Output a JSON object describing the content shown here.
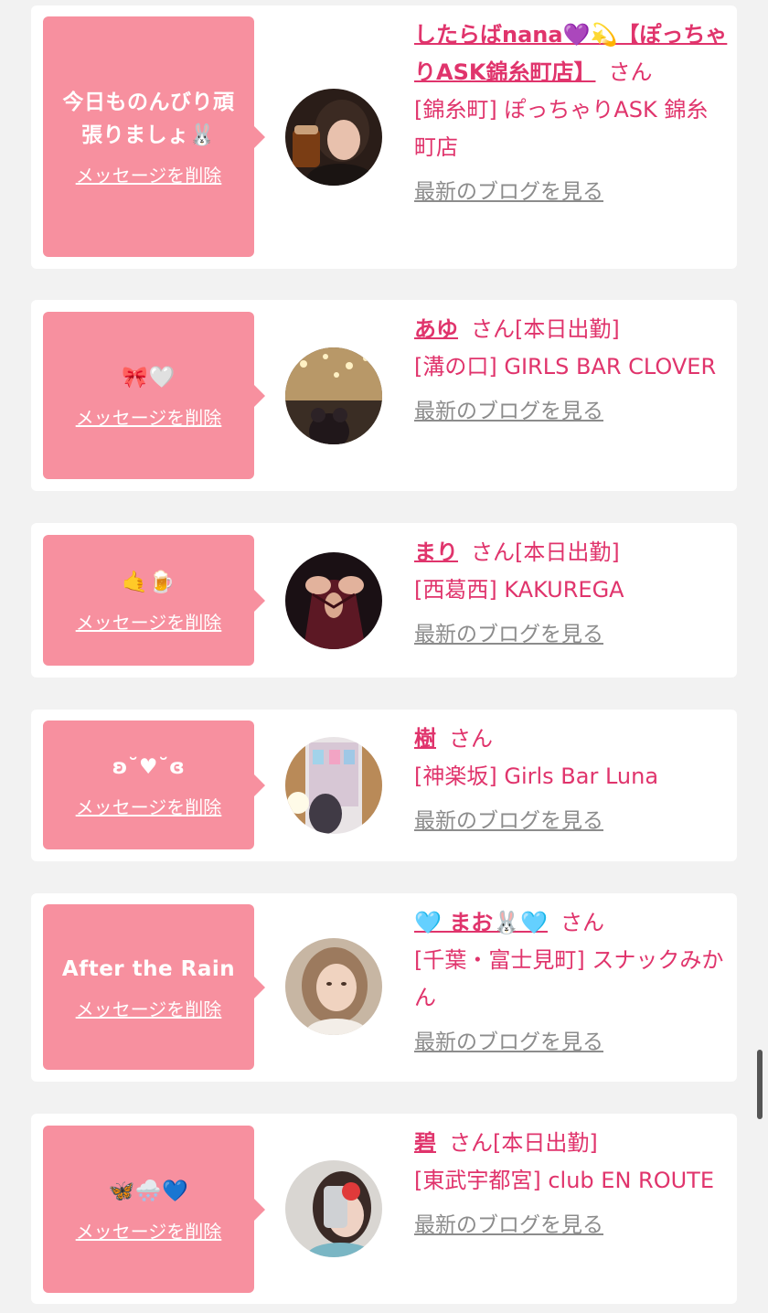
{
  "cards": [
    {
      "message": "今日ものんびり頑張りましょ🐰",
      "delete_label": "メッセージを削除",
      "name": "したらばnana💜💫【ぽっちゃりASK錦糸町店】",
      "san": "さん",
      "status": "",
      "shop": "[錦糸町] ぽっちゃりASK 錦糸町店",
      "blog_label": "最新のブログを見る"
    },
    {
      "message": "🎀🤍",
      "delete_label": "メッセージを削除",
      "name": "あゆ",
      "san": "さん",
      "status": "[本日出勤]",
      "shop": "[溝の口] GIRLS BAR CLOVER",
      "blog_label": "最新のブログを見る"
    },
    {
      "message": "🤙🍺",
      "delete_label": "メッセージを削除",
      "name": "まり",
      "san": "さん",
      "status": "[本日出勤]",
      "shop": "[西葛西] KAKUREGA",
      "blog_label": "最新のブログを見る"
    },
    {
      "message": "ʚ˘♥˘ɞ",
      "delete_label": "メッセージを削除",
      "name": "樹",
      "san": "さん",
      "status": "",
      "shop": "[神楽坂] Girls Bar Luna",
      "blog_label": "最新のブログを見る"
    },
    {
      "message": "After the Rain",
      "delete_label": "メッセージを削除",
      "name": "🩵 まお🐰🩵",
      "san": "さん",
      "status": "",
      "shop": "[千葉・富士見町] スナックみかん",
      "blog_label": "最新のブログを見る"
    },
    {
      "message": "🦋🌨️💙",
      "delete_label": "メッセージを削除",
      "name": "碧",
      "san": "さん",
      "status": "[本日出勤]",
      "shop": "[東武宇都宮] club EN ROUTE",
      "blog_label": "最新のブログを見る"
    }
  ]
}
